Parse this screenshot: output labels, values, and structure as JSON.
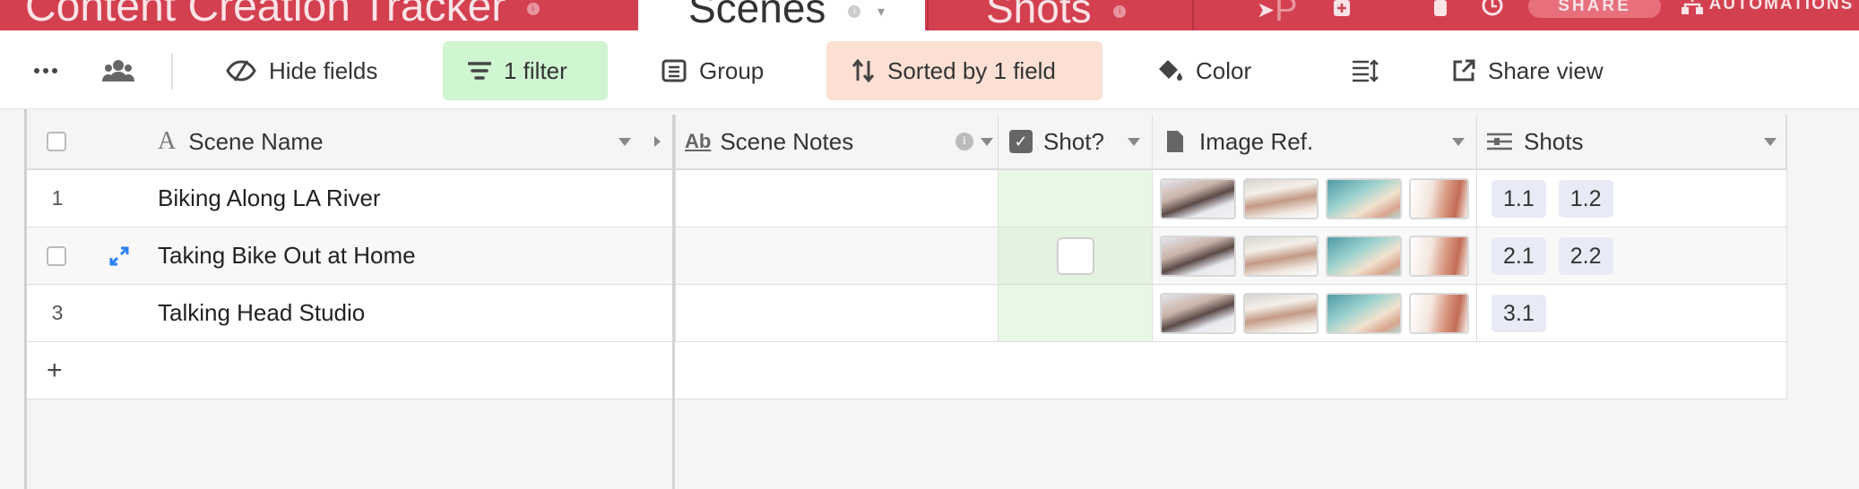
{
  "app": {
    "base_title": "Content Creation Tracker",
    "tabs": [
      {
        "label": "Scenes",
        "active": true
      },
      {
        "label": "Shots",
        "active": false
      },
      {
        "label": "P",
        "active": false
      }
    ],
    "share_label": "SHARE",
    "automations_label": "AUTOMATIONS"
  },
  "toolbar": {
    "hide_fields": "Hide fields",
    "filter": "1 filter",
    "group": "Group",
    "sort": "Sorted by 1 field",
    "color": "Color",
    "share_view": "Share view"
  },
  "columns": {
    "name": "Scene Name",
    "notes": "Scene Notes",
    "shot": "Shot?",
    "image": "Image Ref.",
    "shots": "Shots"
  },
  "rows": [
    {
      "num": "1",
      "name": "Biking Along LA River",
      "notes": "",
      "shot_checked": false,
      "show_checkbox": false,
      "shots": [
        "1.1",
        "1.2"
      ]
    },
    {
      "num": "",
      "name": "Taking Bike Out at Home",
      "notes": "",
      "shot_checked": false,
      "show_checkbox": true,
      "shots": [
        "2.1",
        "2.2"
      ]
    },
    {
      "num": "3",
      "name": "Talking Head Studio",
      "notes": "",
      "shot_checked": false,
      "show_checkbox": false,
      "shots": [
        "3.1"
      ]
    }
  ],
  "add_row_symbol": "+",
  "colors": {
    "topbar": "#d3404f",
    "filter_active": "#cff5d1",
    "sort_active": "#fde0d3",
    "shot_column_tint": "#e9f8e6",
    "chip": "#e8ebf5",
    "expand_icon": "#2d7ff9"
  }
}
